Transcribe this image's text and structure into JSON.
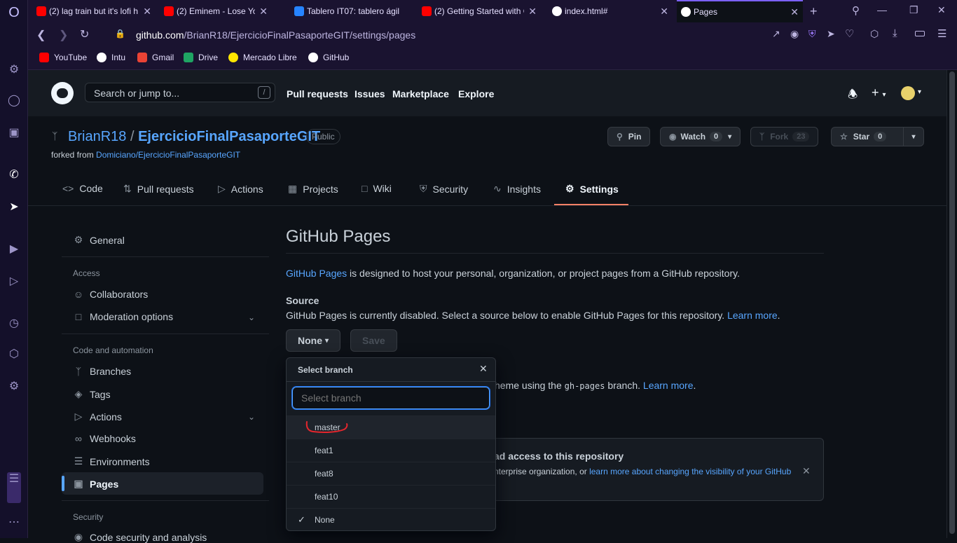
{
  "browser": {
    "tabs": [
      {
        "title": "(2) lag train but it's lofi h",
        "favicon_color": "#ff0000"
      },
      {
        "title": "(2) Eminem - Lose Yo",
        "favicon_color": "#ff0000"
      },
      {
        "title": "Tablero IT07: tablero ágil",
        "favicon_color": "#2684ff"
      },
      {
        "title": "(2) Getting Started with G",
        "favicon_color": "#ff0000"
      },
      {
        "title": "index.html#",
        "favicon_color": "#ffffff"
      },
      {
        "title": "Pages",
        "favicon_color": "#ffffff"
      }
    ],
    "address": {
      "host": "github.com",
      "path": "/BrianR18/EjercicioFinalPasaporteGIT/settings/pages"
    },
    "bookmarks": [
      {
        "label": "YouTube",
        "color": "#ff0000"
      },
      {
        "label": "Intu",
        "color": "#ffffff"
      },
      {
        "label": "Gmail",
        "color": "#ea4335"
      },
      {
        "label": "Drive",
        "color": "#1fa463"
      },
      {
        "label": "Mercado Libre",
        "color": "#ffe600"
      },
      {
        "label": "GitHub",
        "color": "#ffffff"
      }
    ]
  },
  "header": {
    "search_placeholder": "Search or jump to...",
    "search_shortcut": "/",
    "nav": [
      "Pull requests",
      "Issues",
      "Marketplace",
      "Explore"
    ]
  },
  "repo": {
    "owner": "BrianR18",
    "separator": "/",
    "name": "EjercicioFinalPasaporteGIT",
    "visibility": "Public",
    "forked_prefix": "forked from",
    "forked_from": "Domiciano/EjercicioFinalPasaporteGIT",
    "pin_label": "Pin",
    "watch_label": "Watch",
    "watch_count": "0",
    "fork_label": "Fork",
    "fork_count": "23",
    "star_label": "Star",
    "star_count": "0",
    "tabs": [
      "Code",
      "Pull requests",
      "Actions",
      "Projects",
      "Wiki",
      "Security",
      "Insights",
      "Settings"
    ]
  },
  "settings_nav": {
    "general": "General",
    "access_heading": "Access",
    "collaborators": "Collaborators",
    "moderation": "Moderation options",
    "code_heading": "Code and automation",
    "branches": "Branches",
    "tags": "Tags",
    "actions": "Actions",
    "webhooks": "Webhooks",
    "environments": "Environments",
    "pages": "Pages",
    "security_heading": "Security",
    "security_item": "Code security and analysis"
  },
  "main": {
    "title": "GitHub Pages",
    "intro_link": "GitHub Pages",
    "intro_text": " is designed to host your personal, organization, or project pages from a GitHub repository.",
    "source_heading": "Source",
    "source_text": "GitHub Pages is currently disabled. Select a source below to enable GitHub Pages for this repository.",
    "learn_more": "Learn more",
    "source_button": "None",
    "save_button": "Save",
    "theme_text": "heme using the",
    "theme_code": "gh-pages",
    "theme_suffix": "branch.",
    "theme_learn_more": "Learn more",
    "notice_title": "ad access to this repository",
    "notice_text": "nterprise organization, or",
    "notice_link": "learn more about changing the visibility of your GitHub"
  },
  "branch_menu": {
    "title": "Select branch",
    "filter_placeholder": "Select branch",
    "branches": [
      "master",
      "feat1",
      "feat8",
      "feat10",
      "None"
    ],
    "selected": "None"
  },
  "colors": {
    "accent": "#58a6ff",
    "active_tab_underline": "#f78166",
    "annotation": "#e5262d"
  }
}
